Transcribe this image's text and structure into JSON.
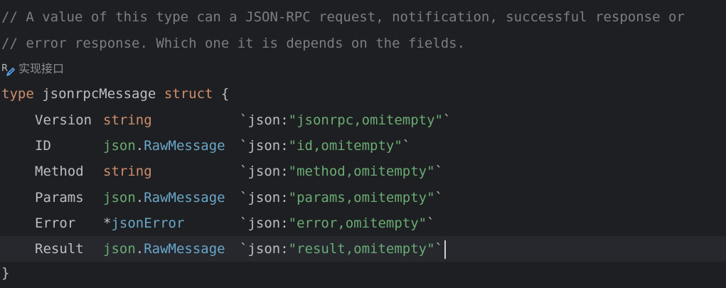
{
  "comments": [
    "// A value of this type can a JSON-RPC request, notification, successful response or",
    "// error response. Which one it is depends on the fields."
  ],
  "inlay_hint": {
    "icon": "implement-icon",
    "label": "实现接口"
  },
  "struct_decl": {
    "kw_type": "type",
    "name": "jsonrpcMessage",
    "kw_struct": "struct",
    "open_brace": "{",
    "close_brace": "}"
  },
  "fields": [
    {
      "name": "Version",
      "prefix": "",
      "pkg": "",
      "dot": "",
      "type": "string",
      "builtin": true,
      "tag_open": "`json:",
      "tag_value": "\"jsonrpc,omitempty\"",
      "tag_close": "`"
    },
    {
      "name": "ID",
      "prefix": "",
      "pkg": "json",
      "dot": ".",
      "type": "RawMessage",
      "builtin": false,
      "tag_open": "`json:",
      "tag_value": "\"id,omitempty\"",
      "tag_close": "`"
    },
    {
      "name": "Method",
      "prefix": "",
      "pkg": "",
      "dot": "",
      "type": "string",
      "builtin": true,
      "tag_open": "`json:",
      "tag_value": "\"method,omitempty\"",
      "tag_close": "`"
    },
    {
      "name": "Params",
      "prefix": "",
      "pkg": "json",
      "dot": ".",
      "type": "RawMessage",
      "builtin": false,
      "tag_open": "`json:",
      "tag_value": "\"params,omitempty\"",
      "tag_close": "`"
    },
    {
      "name": "Error",
      "prefix": "*",
      "pkg": "",
      "dot": "",
      "type": "jsonError",
      "builtin": false,
      "tag_open": "`json:",
      "tag_value": "\"error,omitempty\"",
      "tag_close": "`"
    },
    {
      "name": "Result",
      "prefix": "",
      "pkg": "json",
      "dot": ".",
      "type": "RawMessage",
      "builtin": false,
      "tag_open": "`json:",
      "tag_value": "\"result,omitempty\"",
      "tag_close": "`"
    }
  ],
  "colors": {
    "background": "#1e1f22",
    "current_line": "#26282e",
    "comment": "#7a7e85",
    "keyword": "#cf8e6d",
    "type_ref": "#6aa7c9",
    "string": "#6aab73",
    "text": "#bcbec4"
  }
}
